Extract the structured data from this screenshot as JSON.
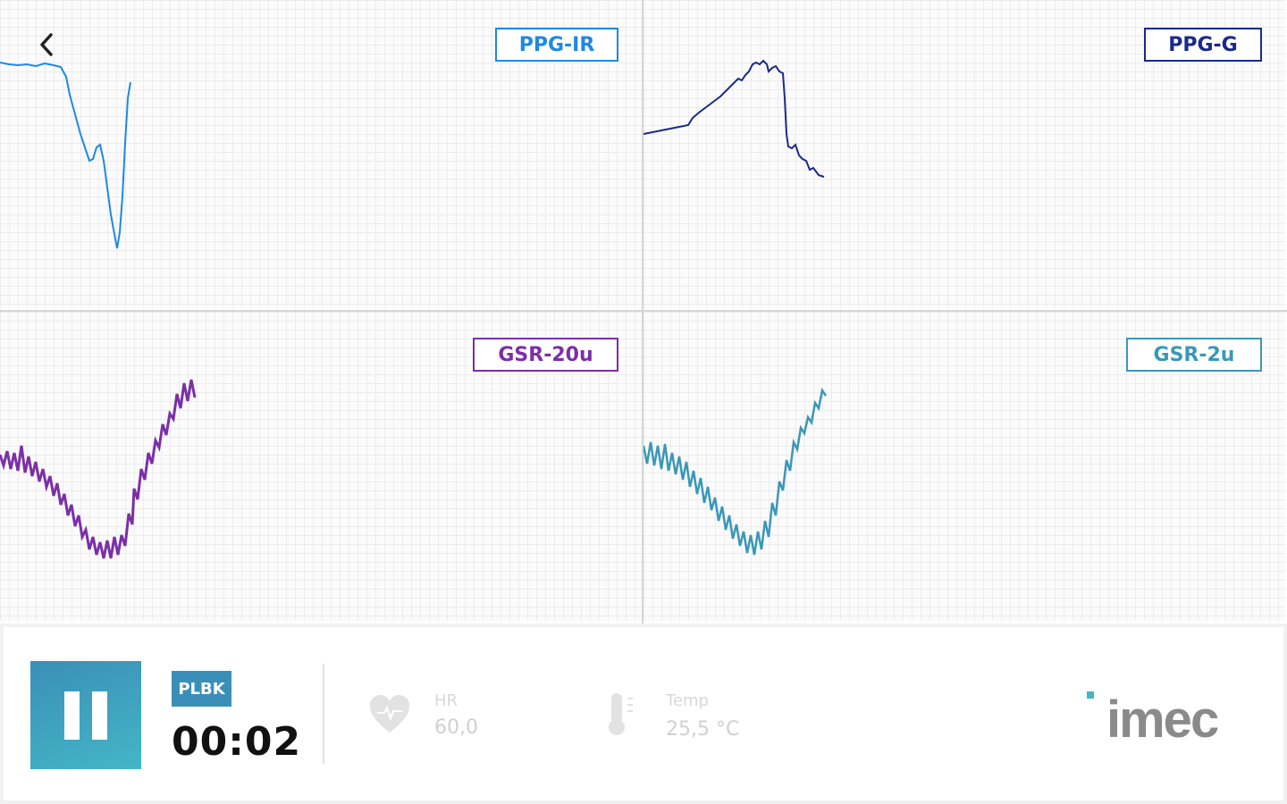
{
  "panels": {
    "ppg_ir": {
      "label": "PPG-IR",
      "color": "#1e88e5"
    },
    "ppg_g": {
      "label": "PPG-G",
      "color": "#1a2a8a"
    },
    "gsr_20u": {
      "label": "GSR-20u",
      "color": "#7b2fa8"
    },
    "gsr_2u": {
      "label": "GSR-2u",
      "color": "#3a98b8"
    }
  },
  "controls": {
    "mode_badge": "PLBK",
    "timer": "00:02"
  },
  "metrics": {
    "hr": {
      "label": "HR",
      "value": "60,0",
      "icon": "heart-icon"
    },
    "temp": {
      "label": "Temp",
      "value": "25,5 °C",
      "icon": "thermometer-icon"
    }
  },
  "brand": {
    "logo_text": "imec",
    "accent": "#44b6c6"
  },
  "icons": {
    "back": "chevron-left-icon",
    "pause": "pause-icon"
  }
}
